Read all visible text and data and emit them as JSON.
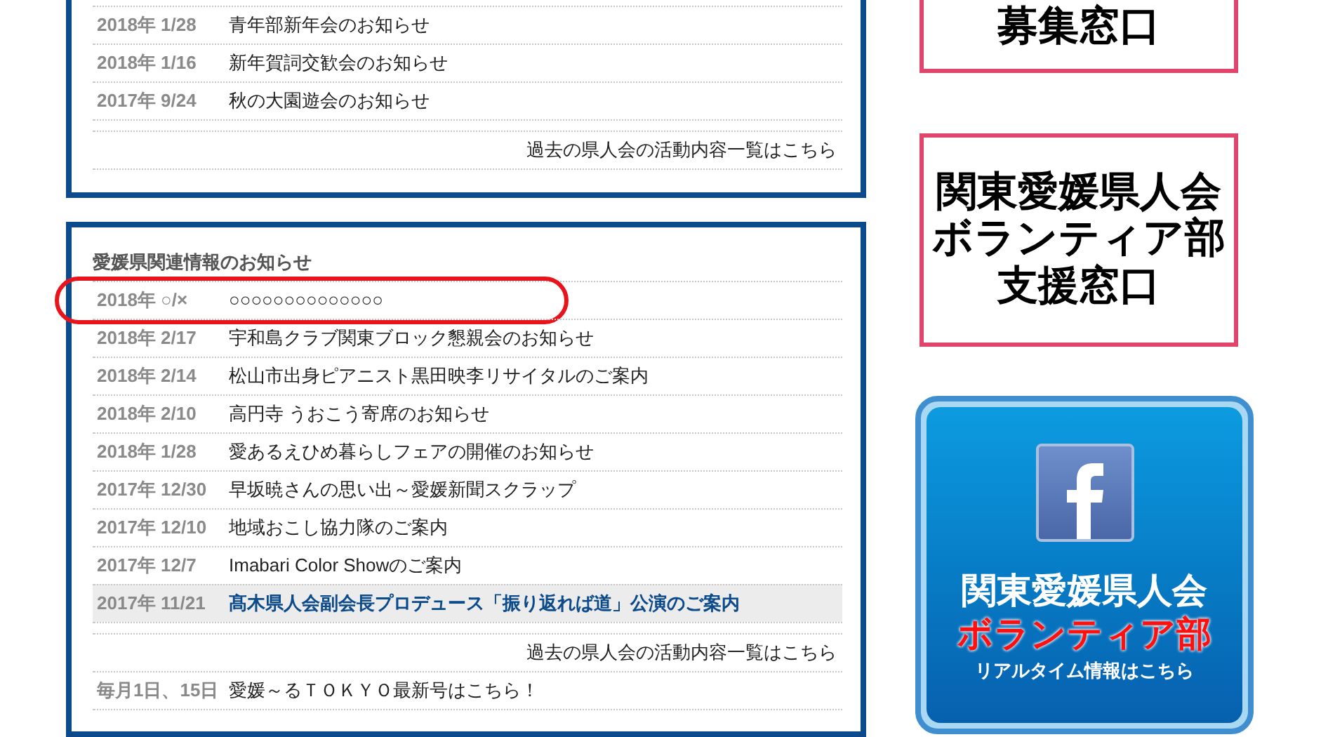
{
  "activity_panel": {
    "rows": [
      {
        "date": "2018年 1/28",
        "title": "青年部新年会のお知らせ"
      },
      {
        "date": "2018年 1/16",
        "title": "新年賀詞交歓会のお知らせ"
      },
      {
        "date": "2017年 9/24",
        "title": "秋の大園遊会のお知らせ"
      }
    ],
    "more_link": "過去の県人会の活動内容一覧はこちら"
  },
  "info_panel": {
    "heading": "愛媛県関連情報のお知らせ",
    "rows": [
      {
        "date": "2018年 ○/×",
        "title": "○○○○○○○○○○○○○○",
        "circled": true,
        "highlighted": false
      },
      {
        "date": "2018年 2/17",
        "title": "宇和島クラブ関東ブロック懇親会のお知らせ",
        "circled": false,
        "highlighted": false
      },
      {
        "date": "2018年 2/14",
        "title": "松山市出身ピアニスト黒田映李リサイタルのご案内",
        "circled": false,
        "highlighted": false
      },
      {
        "date": "2018年 2/10",
        "title": "高円寺 うおこう寄席のお知らせ",
        "circled": false,
        "highlighted": false
      },
      {
        "date": "2018年 1/28",
        "title": "愛あるえひめ暮らしフェアの開催のお知らせ",
        "circled": false,
        "highlighted": false
      },
      {
        "date": "2017年 12/30",
        "title": "早坂暁さんの思い出～愛媛新聞スクラップ",
        "circled": false,
        "highlighted": false
      },
      {
        "date": "2017年 12/10",
        "title": "地域おこし協力隊のご案内",
        "circled": false,
        "highlighted": false
      },
      {
        "date": "2017年 12/7",
        "title": "Imabari Color Showのご案内",
        "circled": false,
        "highlighted": false
      },
      {
        "date": "2017年 11/21",
        "title": "髙木県人会副会長プロデュース「振り返れば道」公演のご案内",
        "circled": false,
        "highlighted": true
      }
    ],
    "more_link": "過去の県人会の活動内容一覧はこちら",
    "footer_row": {
      "date": "毎月1日、15日",
      "title": "愛媛～るＴＯＫＹＯ最新号はこちら！"
    }
  },
  "sidebar": {
    "banners": [
      {
        "kind": "text",
        "lines": [
          "募集窓口"
        ]
      },
      {
        "kind": "text",
        "lines": [
          "関東愛媛県人会",
          "ボランティア部",
          "支援窓口"
        ]
      },
      {
        "kind": "facebook",
        "lines": [
          "関東愛媛県人会",
          "ボランティア部",
          "リアルタイム情報はこちら"
        ]
      }
    ]
  }
}
